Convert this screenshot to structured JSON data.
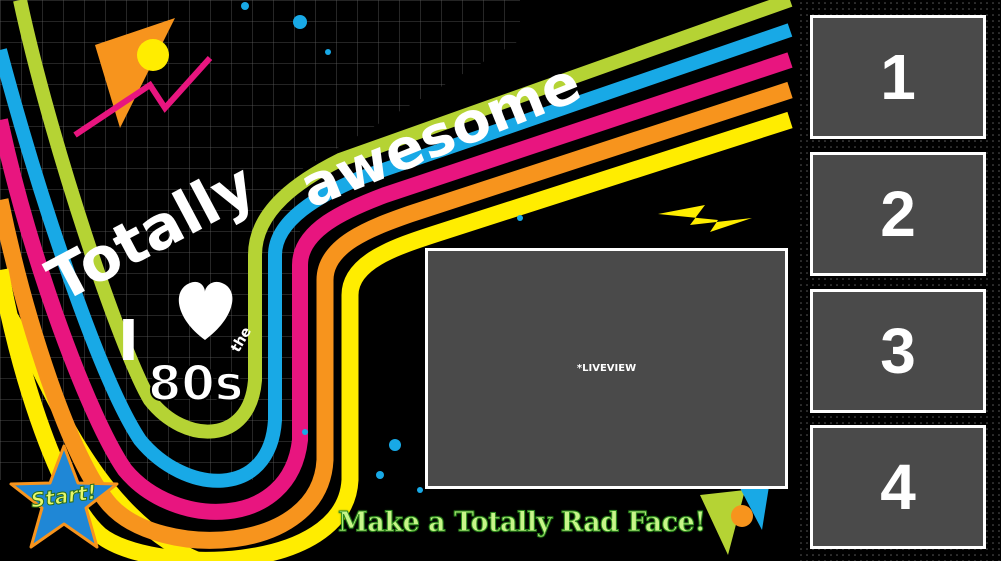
{
  "banner": {
    "headline_word1": "Totally",
    "headline_word2": "awesome",
    "love_i": "I",
    "love_the": "the",
    "love_decade": "80s"
  },
  "liveview": {
    "label": "*LIVEVIEW"
  },
  "slots": [
    {
      "number": "1"
    },
    {
      "number": "2"
    },
    {
      "number": "3"
    },
    {
      "number": "4"
    }
  ],
  "start": {
    "label": "Start!"
  },
  "tagline": "Make a Totally Rad Face!",
  "colors": {
    "background": "#000000",
    "stripe_lime": "#b5d334",
    "stripe_blue": "#18a9e6",
    "stripe_pink": "#e8157f",
    "stripe_orange": "#f7941d",
    "stripe_yellow": "#ffed00",
    "panel_gray": "#4a4a4a",
    "tagline_fill": "#c8f58a"
  }
}
